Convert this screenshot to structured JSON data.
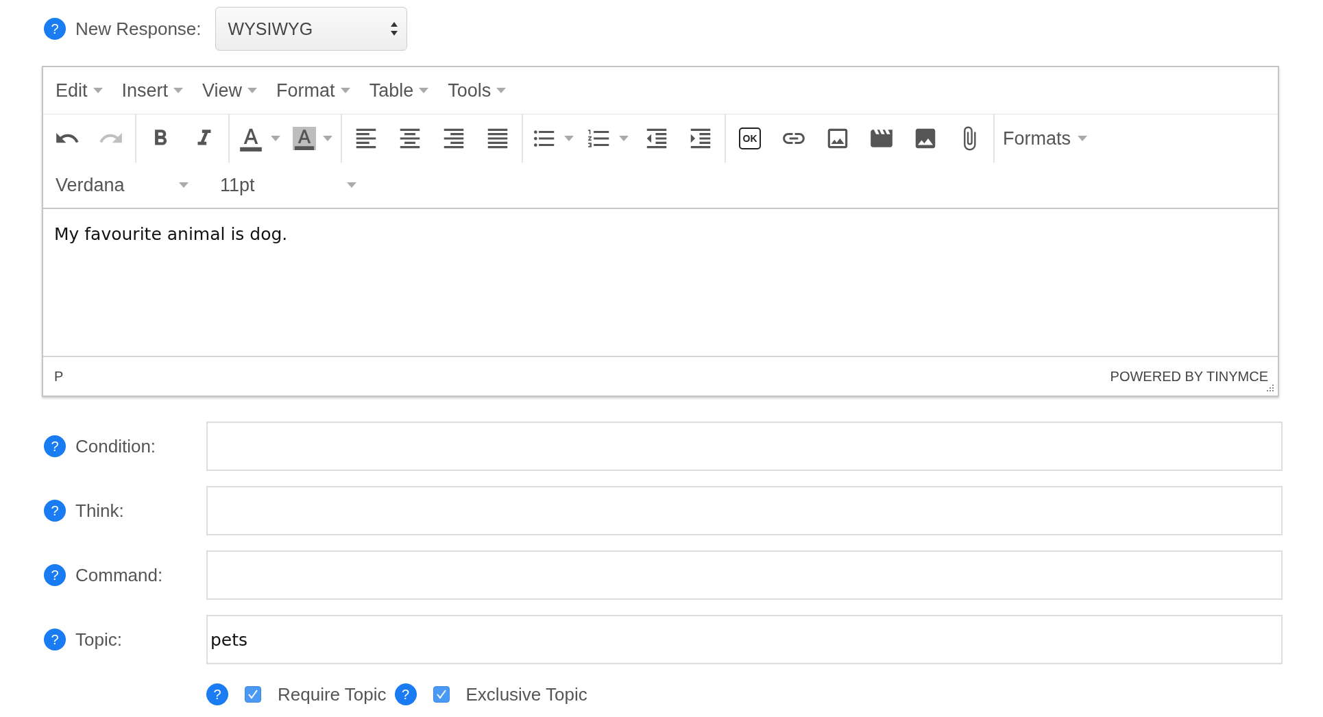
{
  "new_response": {
    "help": "?",
    "label": "New Response:",
    "value": "WYSIWYG"
  },
  "editor": {
    "menus": [
      {
        "label": "Edit"
      },
      {
        "label": "Insert"
      },
      {
        "label": "View"
      },
      {
        "label": "Format"
      },
      {
        "label": "Table"
      },
      {
        "label": "Tools"
      }
    ],
    "toolbar": {
      "groups": [
        {
          "items": [
            {
              "kind": "undo",
              "disabled": false
            },
            {
              "kind": "redo",
              "disabled": true
            }
          ]
        },
        {
          "items": [
            {
              "kind": "bold",
              "disabled": false
            },
            {
              "kind": "italic",
              "disabled": false
            }
          ]
        },
        {
          "items": [
            {
              "kind": "forecolor",
              "split": true,
              "disabled": false
            },
            {
              "kind": "backcolor",
              "split": true,
              "disabled": false
            }
          ]
        },
        {
          "items": [
            {
              "kind": "align-left",
              "disabled": false
            },
            {
              "kind": "align-center",
              "disabled": false
            },
            {
              "kind": "align-right",
              "disabled": false
            },
            {
              "kind": "justify",
              "disabled": false
            }
          ]
        },
        {
          "items": [
            {
              "kind": "bullist",
              "split": true,
              "disabled": false
            },
            {
              "kind": "numlist",
              "split": true,
              "disabled": false
            },
            {
              "kind": "outdent",
              "disabled": false
            },
            {
              "kind": "indent",
              "disabled": false
            }
          ]
        },
        {
          "items": [
            {
              "kind": "template",
              "label": "OK",
              "disabled": false
            },
            {
              "kind": "link",
              "disabled": false
            },
            {
              "kind": "image",
              "disabled": false
            },
            {
              "kind": "media",
              "disabled": false
            },
            {
              "kind": "photo",
              "disabled": false
            },
            {
              "kind": "attach",
              "disabled": false
            }
          ]
        },
        {
          "items": [
            {
              "kind": "menu",
              "label": "Formats",
              "disabled": false
            }
          ]
        }
      ],
      "font_family": "Verdana",
      "font_size": "11pt"
    },
    "content": "My favourite animal is dog.",
    "path": "P",
    "branding": "POWERED BY TINYMCE"
  },
  "fields": [
    {
      "help": "?",
      "label": "Condition:"
    },
    {
      "help": "?",
      "label": "Think:"
    },
    {
      "help": "?",
      "label": "Command:"
    },
    {
      "help": "?",
      "label": "Topic:",
      "value": "pets"
    }
  ],
  "options": [
    {
      "help": "?",
      "label": "Require Topic",
      "checked": true
    },
    {
      "help": "?",
      "label": "Exclusive Topic",
      "checked": true
    }
  ]
}
